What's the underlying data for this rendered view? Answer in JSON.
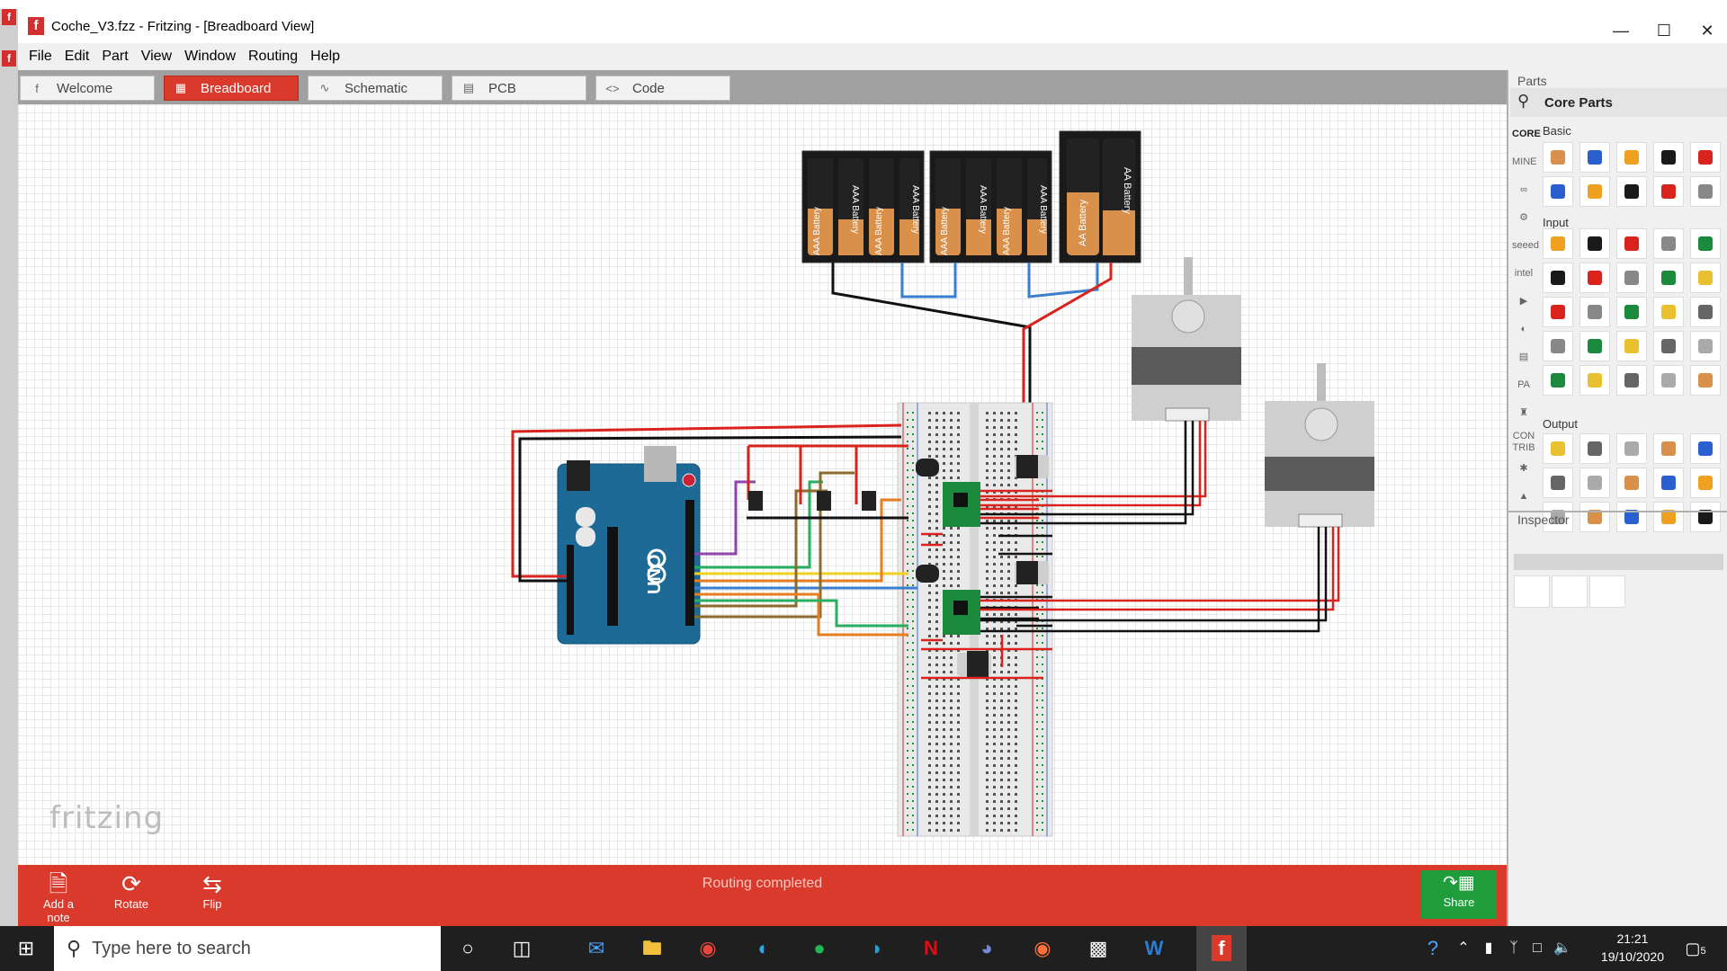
{
  "window": {
    "title": "Coche_V3.fzz - Fritzing - [Breadboard View]",
    "app_icon": "f",
    "controls": [
      "minimize-icon",
      "maximize-icon",
      "close-icon"
    ]
  },
  "menu": [
    "File",
    "Edit",
    "Part",
    "View",
    "Window",
    "Routing",
    "Help"
  ],
  "tabs": [
    {
      "label": "Welcome",
      "icon": "fritzing-icon",
      "active": false
    },
    {
      "label": "Breadboard",
      "icon": "breadboard-icon",
      "active": true
    },
    {
      "label": "Schematic",
      "icon": "schematic-icon",
      "active": false
    },
    {
      "label": "PCB",
      "icon": "pcb-icon",
      "active": false
    },
    {
      "label": "Code",
      "icon": "code-icon",
      "active": false
    }
  ],
  "canvas": {
    "watermark": "fritzing",
    "battery_labels": {
      "aaa": "AAA Battery",
      "aa": "AA Battery"
    },
    "arduino_label": "UNO"
  },
  "toolbar": {
    "add_note": "Add a note",
    "rotate": "Rotate",
    "flip": "Flip",
    "status": "Routing completed",
    "share": "Share"
  },
  "parts": {
    "title": "Parts",
    "bin_title": "Core Parts",
    "bins": [
      "CORE",
      "MINE",
      "∞",
      "⚙",
      "seeed",
      "intel",
      "▶",
      "◐",
      "▤",
      "PA",
      "♜",
      "CON TRIB",
      "✱",
      "▲"
    ],
    "sections": {
      "basic": "Basic",
      "input": "Input",
      "output": "Output"
    }
  },
  "inspector": {
    "title": "Inspector"
  },
  "taskbar": {
    "search_placeholder": "Type here to search",
    "time": "21:21",
    "date": "19/10/2020",
    "notifications": "5"
  },
  "colors": {
    "accent_red": "#d93a2b",
    "share_green": "#1f9d3a",
    "arduino_blue": "#1d6a96",
    "pcb_green": "#1b8a3c"
  }
}
